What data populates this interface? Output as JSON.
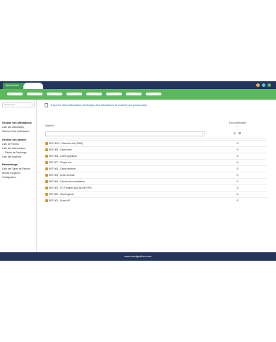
{
  "window": {
    "tab_label": "NextGestion",
    "controls": [
      {
        "name": "minimize",
        "color": "#f0ad4e"
      },
      {
        "name": "maximize",
        "color": "#5bc0de"
      },
      {
        "name": "close",
        "color": "#5cb85c"
      }
    ]
  },
  "sidebar": {
    "select_placeholder": "Rechercher",
    "groups": [
      {
        "title": "Gestion des affectations",
        "items": [
          "Liste des affectations",
          "Générer l'état d'affectation"
        ]
      },
      {
        "title": "Gestion des pannes",
        "items": [
          "Liste de Pannes",
          "Liste des interventions"
        ],
        "subitems": [
          "Pièces de Rechange"
        ],
        "items_after": [
          "Liste des solutions"
        ]
      },
      {
        "title": "Paramétrage",
        "items": [
          "Liste des Types de Pannes",
          "Niveau d'urgence",
          "Configuration"
        ]
      }
    ]
  },
  "main": {
    "export_link": "Exporter l'état d'affectation (Historique des affectations du matériel aux personnels)",
    "table": {
      "columns": [
        "Materiel",
        "Etat d'affectation"
      ],
      "rows": [
        "REF-0010 - Mémoire vive (RAM)",
        "REF-009 - Carte mère",
        "REF-008 - Carte graphique",
        "REF-007 - Disque dur",
        "REF-006 - Carte mémoire",
        "REF-005 - Unité centrale",
        "REF-004 - Caméra de surveillance",
        "REF-002 - PC Portable MAC BOOK PRO",
        "REF-003 - Souris gamer",
        "REF-001 - Ecran HP"
      ]
    }
  },
  "footer": {
    "text": "www.nextgestion.com"
  },
  "colors": {
    "titlebar": "#24345a",
    "navbar": "#5cb85c",
    "tab": "#3f9b52",
    "link": "#2a6ab2"
  }
}
